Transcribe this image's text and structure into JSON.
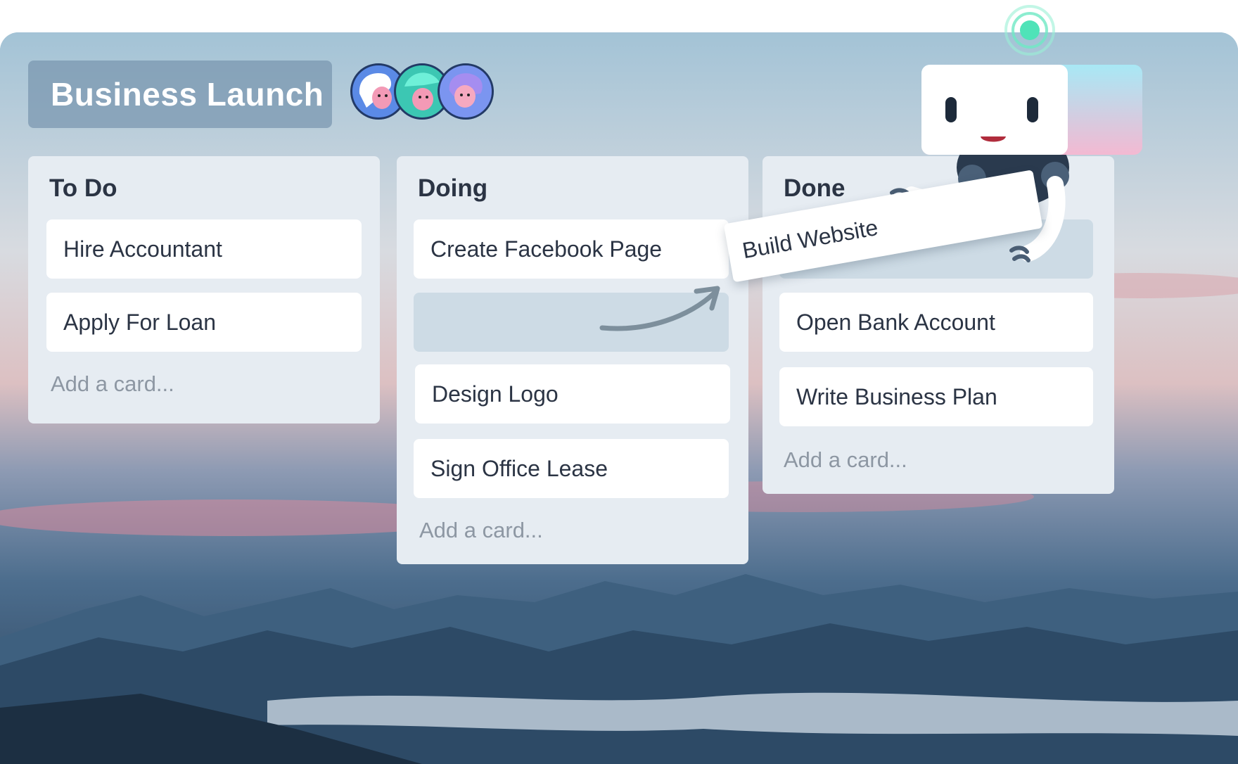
{
  "board": {
    "title": "Business Launch",
    "members": [
      "avatar-1",
      "avatar-2",
      "avatar-3"
    ]
  },
  "lists": [
    {
      "title": "To Do",
      "cards": [
        "Hire Accountant",
        "Apply For Loan"
      ],
      "add_card": "Add a card..."
    },
    {
      "title": "Doing",
      "cards": [
        "Create Facebook Page",
        "Design Logo",
        "Sign Office Lease"
      ],
      "add_card": "Add a card..."
    },
    {
      "title": "Done",
      "cards": [
        "Open Bank Account",
        "Write Business Plan"
      ],
      "add_card": "Add a card..."
    }
  ],
  "dragging_card": "Build Website",
  "icons": [
    "robot-mascot-icon",
    "notification-pulse-icon",
    "drag-arrow-icon"
  ],
  "colors": {
    "list_bg": "#e6ecf2",
    "card_bg": "#ffffff",
    "placeholder": "#cddbe5",
    "pulse": "#4fe3b8"
  }
}
